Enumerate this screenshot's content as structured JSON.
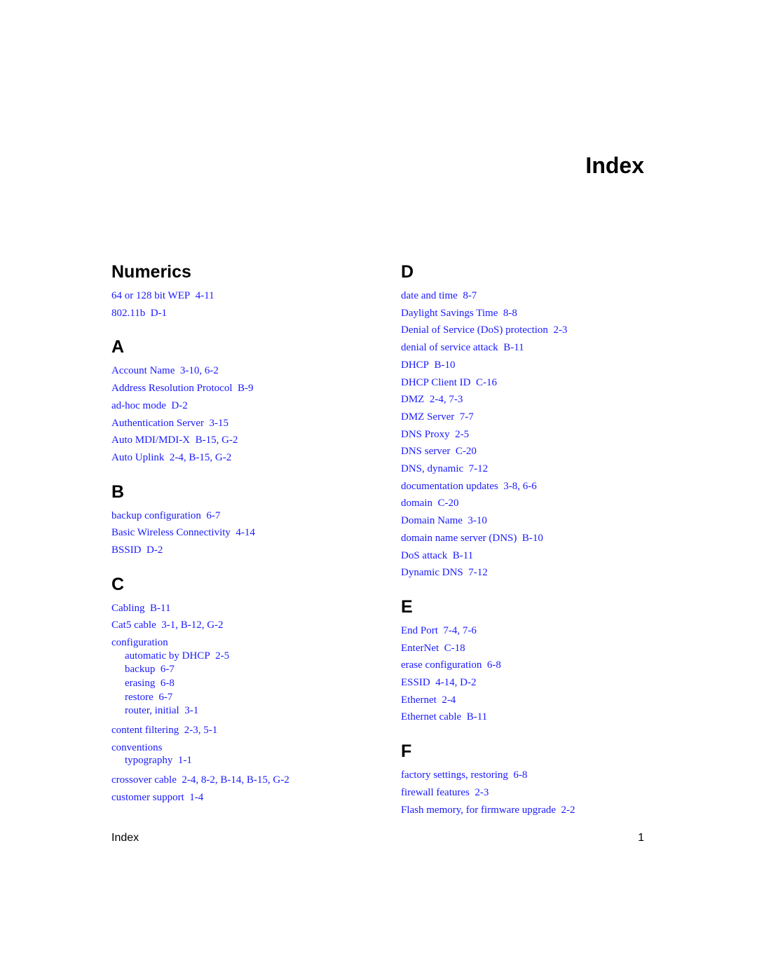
{
  "page_title": "Index",
  "colors": {
    "link": "#1a1aff",
    "heading": "#000000"
  },
  "left_column": [
    {
      "heading": "Numerics",
      "entries": [
        {
          "term": "64 or 128 bit WEP",
          "pages": "4-11"
        },
        {
          "term": "802.11b",
          "pages": "D-1"
        }
      ]
    },
    {
      "heading": "A",
      "entries": [
        {
          "term": "Account Name",
          "pages": "3-10, 6-2"
        },
        {
          "term": "Address Resolution Protocol",
          "pages": "B-9"
        },
        {
          "term": "ad-hoc mode",
          "pages": "D-2"
        },
        {
          "term": "Authentication Server",
          "pages": "3-15"
        },
        {
          "term": "Auto MDI/MDI-X",
          "pages": "B-15, G-2"
        },
        {
          "term": "Auto Uplink",
          "pages": "2-4, B-15, G-2"
        }
      ]
    },
    {
      "heading": "B",
      "entries": [
        {
          "term": "backup configuration",
          "pages": "6-7"
        },
        {
          "term": "Basic Wireless Connectivity",
          "pages": "4-14"
        },
        {
          "term": "BSSID",
          "pages": "D-2"
        }
      ]
    },
    {
      "heading": "C",
      "entries": [
        {
          "term": "Cabling",
          "pages": "B-11"
        },
        {
          "term": "Cat5 cable",
          "pages": "3-1, B-12, G-2"
        },
        {
          "term": "configuration",
          "pages": "",
          "subentries": [
            {
              "term": "automatic by DHCP",
              "pages": "2-5"
            },
            {
              "term": "backup",
              "pages": "6-7"
            },
            {
              "term": "erasing",
              "pages": "6-8"
            },
            {
              "term": "restore",
              "pages": "6-7"
            },
            {
              "term": "router, initial",
              "pages": "3-1"
            }
          ]
        },
        {
          "term": "content filtering",
          "pages": "2-3, 5-1"
        },
        {
          "term": "conventions",
          "pages": "",
          "subentries": [
            {
              "term": "typography",
              "pages": "1-1"
            }
          ]
        },
        {
          "term": "crossover cable",
          "pages": "2-4, 8-2, B-14, B-15, G-2"
        },
        {
          "term": "customer support",
          "pages": "1-4"
        }
      ]
    }
  ],
  "right_column": [
    {
      "heading": "D",
      "entries": [
        {
          "term": "date and time",
          "pages": "8-7"
        },
        {
          "term": "Daylight Savings Time",
          "pages": "8-8"
        },
        {
          "term": "Denial of Service (DoS) protection",
          "pages": "2-3"
        },
        {
          "term": "denial of service attack",
          "pages": "B-11"
        },
        {
          "term": "DHCP",
          "pages": "B-10"
        },
        {
          "term": "DHCP Client ID",
          "pages": "C-16"
        },
        {
          "term": "DMZ",
          "pages": "2-4, 7-3"
        },
        {
          "term": "DMZ Server",
          "pages": "7-7"
        },
        {
          "term": "DNS Proxy",
          "pages": "2-5"
        },
        {
          "term": "DNS server",
          "pages": "C-20"
        },
        {
          "term": "DNS, dynamic",
          "pages": "7-12"
        },
        {
          "term": "documentation updates",
          "pages": "3-8, 6-6"
        },
        {
          "term": "domain",
          "pages": "C-20"
        },
        {
          "term": "Domain Name",
          "pages": "3-10"
        },
        {
          "term": "domain name server (DNS)",
          "pages": "B-10"
        },
        {
          "term": "DoS attack",
          "pages": "B-11"
        },
        {
          "term": "Dynamic DNS",
          "pages": "7-12"
        }
      ]
    },
    {
      "heading": "E",
      "entries": [
        {
          "term": "End Port",
          "pages": "7-4, 7-6"
        },
        {
          "term": "EnterNet",
          "pages": "C-18"
        },
        {
          "term": "erase configuration",
          "pages": "6-8"
        },
        {
          "term": "ESSID",
          "pages": "4-14, D-2"
        },
        {
          "term": "Ethernet",
          "pages": "2-4"
        },
        {
          "term": "Ethernet cable",
          "pages": "B-11"
        }
      ]
    },
    {
      "heading": "F",
      "entries": [
        {
          "term": "factory settings, restoring",
          "pages": "6-8"
        },
        {
          "term": "firewall features",
          "pages": "2-3"
        },
        {
          "term": "Flash memory, for firmware upgrade",
          "pages": "2-2"
        }
      ]
    }
  ],
  "footer": {
    "left": "Index",
    "page_number": "1"
  }
}
